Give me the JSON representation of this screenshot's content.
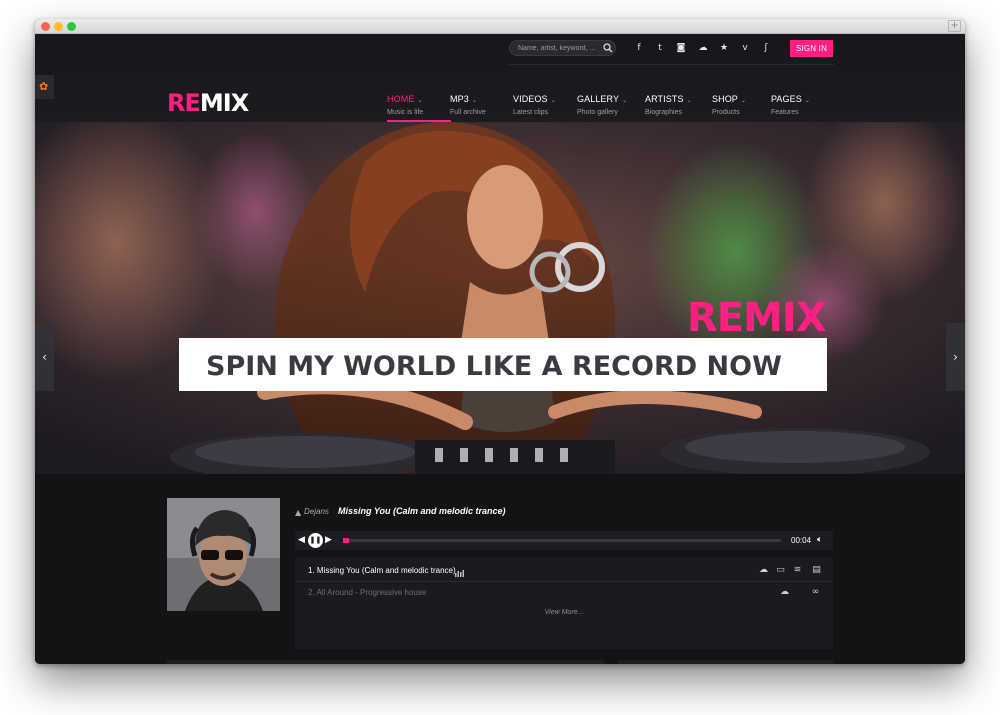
{
  "header": {
    "search": {
      "placeholder": "Name, artist, keyword, ..."
    },
    "social_icons": [
      "facebook-icon",
      "twitter-icon",
      "instagram-icon",
      "soundcloud-icon",
      "star-icon",
      "vimeo-icon",
      "rss-icon"
    ],
    "social_glyphs": {
      "facebook": "f",
      "twitter": "t",
      "instagram": "◙",
      "soundcloud": "☁",
      "star": "★",
      "vimeo": "v",
      "rss": "ʃ"
    },
    "signin_label": "SIGN IN",
    "logo": {
      "part1": "RE",
      "part2": "MIX"
    },
    "nav": [
      {
        "label": "HOME",
        "sub": "Music is life",
        "active": true
      },
      {
        "label": "MP3",
        "sub": "Full archive"
      },
      {
        "label": "VIDEOS",
        "sub": "Latest clips"
      },
      {
        "label": "GALLERY",
        "sub": "Photo gallery"
      },
      {
        "label": "ARTISTS",
        "sub": "Biographies"
      },
      {
        "label": "SHOP",
        "sub": "Products"
      },
      {
        "label": "PAGES",
        "sub": "Features"
      }
    ],
    "chevron": "⌄"
  },
  "hero": {
    "brand": "REMIX",
    "tagline": "SPIN MY WORLD LIKE A RECORD NOW",
    "prev_glyph": "‹",
    "next_glyph": "›"
  },
  "player": {
    "artist": "Dejans",
    "artist_icon_glyph": "▲",
    "title": "Missing You (Calm and melodic trance)",
    "time": "00:04",
    "progress": 0.01,
    "glyphs": {
      "prev": "◀◀",
      "pause": "❚❚",
      "next": "▶▶",
      "volume": "◀)"
    },
    "tracks": [
      {
        "name": "1.  Missing You (Calm and melodic trance)"
      },
      {
        "name": "2.  All Around - Progressive house"
      }
    ],
    "view_more": "View More..."
  },
  "colors": {
    "accent": "#ff1e82",
    "background": "#131316",
    "header": "#19181c"
  }
}
